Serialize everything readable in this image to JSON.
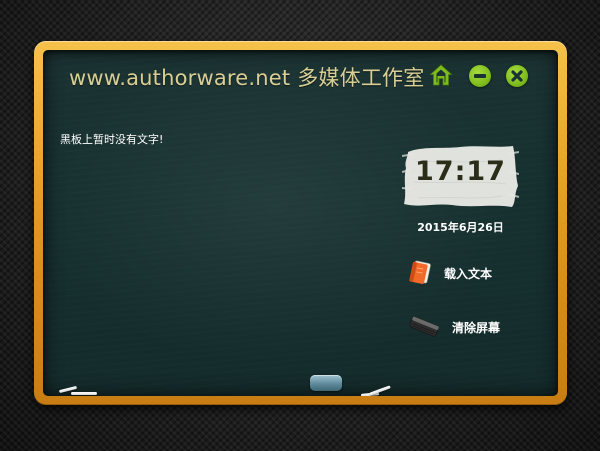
{
  "window": {
    "title": "www.authorware.net 多媒体工作室",
    "controls": {
      "home_icon": "home-icon",
      "minimize_icon": "minus-circle-icon",
      "close_icon": "close-circle-icon"
    }
  },
  "board": {
    "message": "黑板上暂时没有文字!"
  },
  "clock": {
    "time": "17:17",
    "date": "2015年6月26日"
  },
  "actions": {
    "load": {
      "label": "载入文本",
      "icon": "notebook-icon"
    },
    "clear": {
      "label": "清除屏幕",
      "icon": "eraser-icon"
    }
  },
  "colors": {
    "frame": "#e7a32a",
    "board": "#163030",
    "title": "#d9cf94",
    "button_green": "#7fbd1c",
    "clock_text": "#2a2e18"
  }
}
